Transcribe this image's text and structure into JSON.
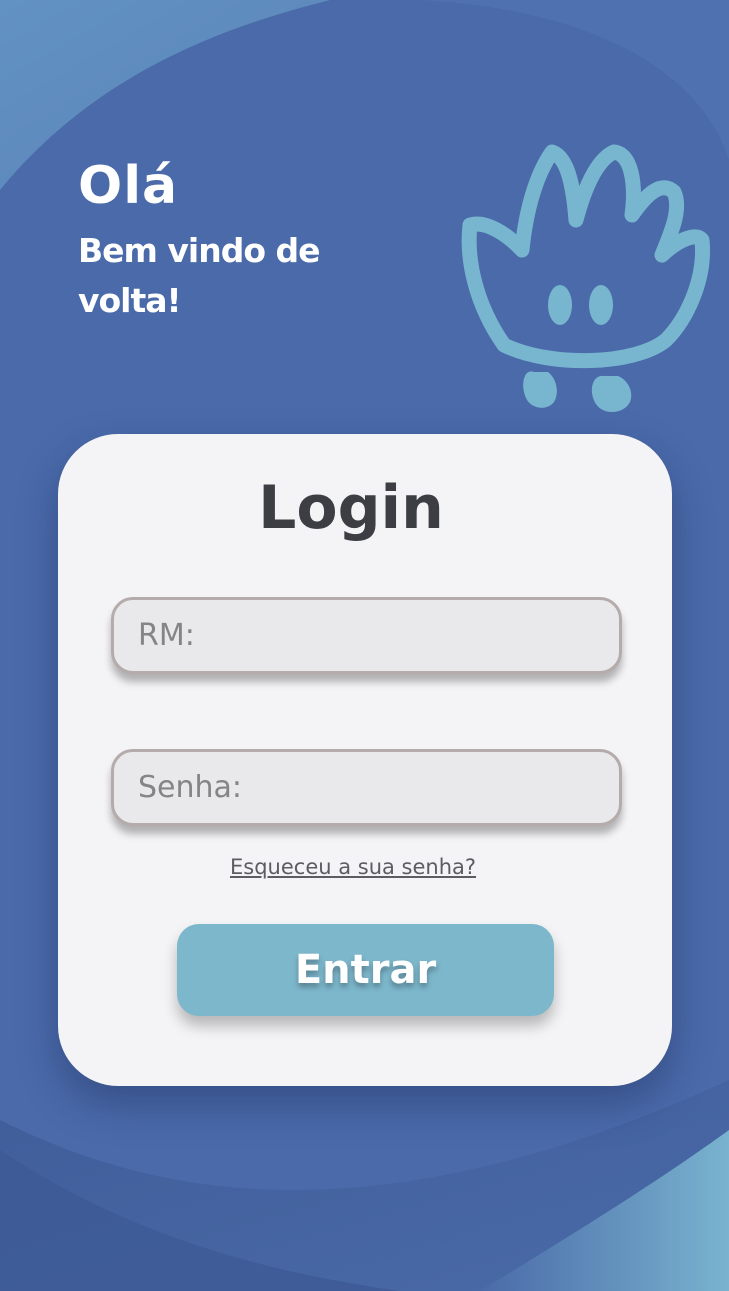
{
  "greeting": {
    "hello": "Olá",
    "welcome": "Bem vindo de volta!"
  },
  "mascot": {
    "icon": "hand-mascot-icon",
    "color": "#78b6d0"
  },
  "login_card": {
    "title": "Login",
    "rm_field": {
      "placeholder": "RM:",
      "value": ""
    },
    "password_field": {
      "placeholder": "Senha:",
      "value": ""
    },
    "forgot_password_link": "Esqueceu a sua senha?",
    "submit_button": "Entrar"
  },
  "colors": {
    "background": "#4868a8",
    "card": "#f4f4f6",
    "accent": "#7db7cc",
    "title_text": "#3d3d44"
  }
}
